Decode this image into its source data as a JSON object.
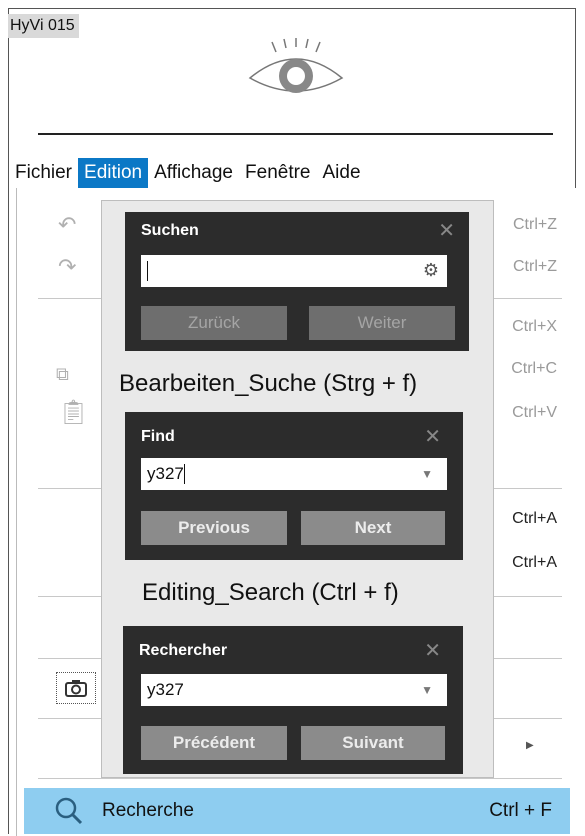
{
  "app_tag": "HyVi 015",
  "menubar": [
    "Fichier",
    "Edition",
    "Affichage",
    "Fenêtre",
    "Aide"
  ],
  "menu_active_index": 1,
  "menu_shortcuts": [
    "Ctrl+Z",
    "Ctrl+Z",
    "Ctrl+X",
    "Ctrl+C",
    "Ctrl+V",
    "Ctrl+A",
    "Ctrl+A"
  ],
  "highlighted_item": {
    "label": "Recherche",
    "shortcut": "Ctrl + F"
  },
  "dialog_de": {
    "title": "Suchen",
    "input_value": "",
    "prev": "Zurück",
    "next": "Weiter"
  },
  "caption_de": "Bearbeiten_Suche (Strg + f)",
  "dialog_en": {
    "title": "Find",
    "input_value": "y327",
    "prev": "Previous",
    "next": "Next"
  },
  "caption_en": "Editing_Search (Ctrl + f)",
  "dialog_fr": {
    "title": "Rechercher",
    "input_value": "y327",
    "prev": "Précédent",
    "next": "Suivant"
  },
  "colors": {
    "menu_active": "#0b78c6",
    "highlight": "#8ecdf0",
    "dialog_bg": "#2c2c2c"
  }
}
